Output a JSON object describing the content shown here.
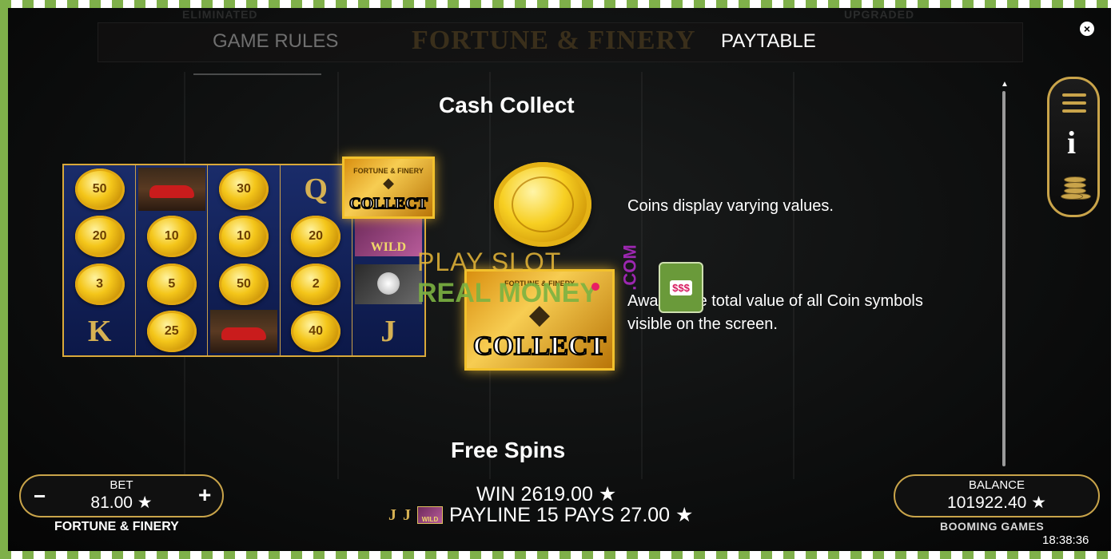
{
  "header": {
    "tab_rules": "GAME RULES",
    "tab_paytable": "PAYTABLE",
    "game_logo": "FORTUNE & FINERY",
    "faint_left": "ELIMINATED",
    "faint_right": "UPGRADED",
    "close_glyph": "×"
  },
  "cash_collect": {
    "title": "Cash Collect",
    "coins_text": "Coins display varying values.",
    "collect_text": "Awards the total value of all Coin symbols visible on the screen.",
    "collect_word": "COLLECT",
    "collect_sub": "FORTUNE & FINERY"
  },
  "mini_reels": {
    "rows": [
      [
        {
          "type": "coin",
          "value": "50"
        },
        {
          "type": "car"
        },
        {
          "type": "coin",
          "value": "30"
        },
        {
          "type": "letter",
          "value": "Q"
        },
        {
          "type": "collect"
        }
      ],
      [
        {
          "type": "coin",
          "value": "20"
        },
        {
          "type": "coin",
          "value": "10"
        },
        {
          "type": "coin",
          "value": "10"
        },
        {
          "type": "coin",
          "value": "20"
        },
        {
          "type": "wild",
          "value": "WILD"
        }
      ],
      [
        {
          "type": "coin",
          "value": "3"
        },
        {
          "type": "coin",
          "value": "5"
        },
        {
          "type": "coin",
          "value": "50"
        },
        {
          "type": "coin",
          "value": "2"
        },
        {
          "type": "watch"
        }
      ],
      [
        {
          "type": "letter",
          "value": "K"
        },
        {
          "type": "coin",
          "value": "25"
        },
        {
          "type": "car"
        },
        {
          "type": "coin",
          "value": "40"
        },
        {
          "type": "letter",
          "value": "J"
        }
      ]
    ]
  },
  "free_spins": {
    "title": "Free Spins"
  },
  "watermark": {
    "line1": "PLAY SLOT",
    "line2": "REAL MONEY",
    "tld": ".COM",
    "machine_reels": "$$$"
  },
  "bet": {
    "label": "BET",
    "value": "81.00 ★",
    "minus": "−",
    "plus": "+"
  },
  "game_name": "FORTUNE & FINERY",
  "win": {
    "text": "WIN 2619.00 ★",
    "payline": "PAYLINE 15 PAYS 27.00 ★",
    "symbols": [
      "J",
      "J"
    ],
    "wild_label": "WILD"
  },
  "balance": {
    "label": "BALANCE",
    "value": "101922.40 ★"
  },
  "provider": "BOOMING GAMES",
  "clock": "18:38:36",
  "side_panel": {
    "info_glyph": "i"
  },
  "icons": [
    "close-icon",
    "menu-icon",
    "info-icon",
    "coins-stack-icon",
    "scroll-up-icon",
    "minus-icon",
    "plus-icon",
    "star-icon"
  ]
}
